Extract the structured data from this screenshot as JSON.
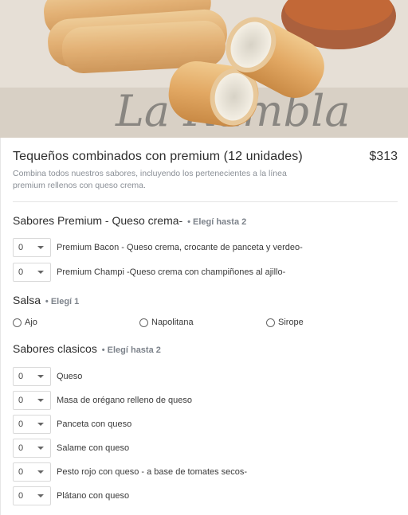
{
  "product": {
    "title": "Tequeños combinados con premium (12 unidades)",
    "price": "$313",
    "description": "Combina todos nuestros sabores, incluyendo los pertenecientes a la línea premium rellenos con queso crema."
  },
  "hero": {
    "watermark_text": "La Rambla"
  },
  "sections": {
    "premium": {
      "title": "Sabores Premium - Queso crema-",
      "hint": "• Elegí hasta 2",
      "items": [
        {
          "qty": "0",
          "label": "Premium Bacon - Queso crema, crocante de panceta y verdeo-"
        },
        {
          "qty": "0",
          "label": "Premium Champi -Queso crema con champiñones al ajillo-"
        }
      ]
    },
    "salsa": {
      "title": "Salsa",
      "hint": "• Elegí 1",
      "options": [
        "Ajo",
        "Napolitana",
        "Sirope"
      ]
    },
    "clasicos": {
      "title": "Sabores clasicos",
      "hint": "• Elegí hasta 2",
      "items": [
        {
          "qty": "0",
          "label": "Queso"
        },
        {
          "qty": "0",
          "label": "Masa de orégano relleno de queso"
        },
        {
          "qty": "0",
          "label": "Panceta con queso"
        },
        {
          "qty": "0",
          "label": "Salame con queso"
        },
        {
          "qty": "0",
          "label": "Pesto rojo con queso - a base de tomates secos-"
        },
        {
          "qty": "0",
          "label": "Plátano con queso"
        }
      ]
    }
  }
}
